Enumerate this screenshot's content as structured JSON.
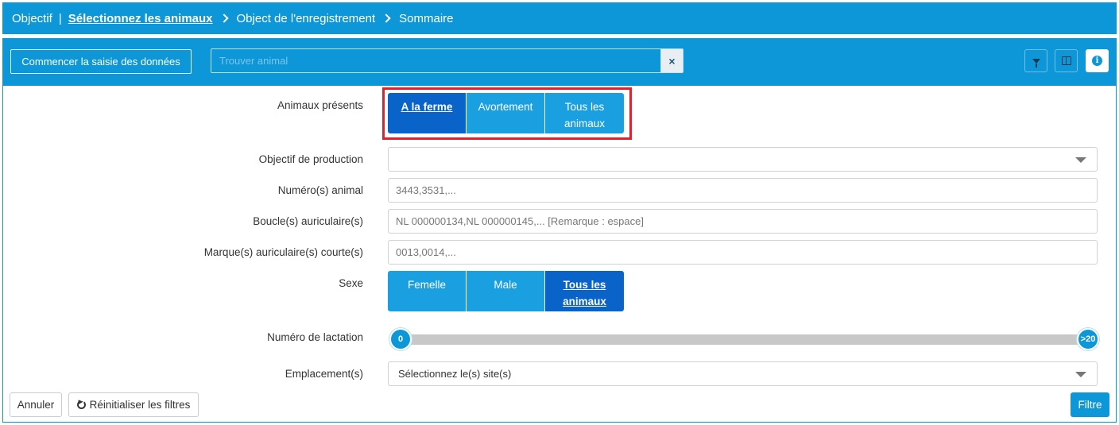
{
  "breadcrumb": {
    "steps": [
      "Objectif",
      "Sélectionnez les animaux",
      "Object de l'enregistrement",
      "Sommaire"
    ],
    "separator": "|"
  },
  "toolbar": {
    "start_label": "Commencer la saisie des données",
    "search_placeholder": "Trouver animal",
    "clear_icon": "×",
    "info_glyph": "i"
  },
  "form": {
    "animaux_presents": {
      "label": "Animaux présents",
      "options": [
        "A la ferme",
        "Avortement",
        "Tous les animaux"
      ],
      "selected": "A la ferme"
    },
    "objectif_production": {
      "label": "Objectif de production",
      "value": ""
    },
    "numero_animal": {
      "label": "Numéro(s) animal",
      "placeholder": "3443,3531,..."
    },
    "boucle": {
      "label": "Boucle(s) auriculaire(s)",
      "placeholder": "NL 000000134,NL 000000145,... [Remarque : espace]"
    },
    "marque": {
      "label": "Marque(s) auriculaire(s) courte(s)",
      "placeholder": "0013,0014,..."
    },
    "sexe": {
      "label": "Sexe",
      "options": [
        "Femelle",
        "Male",
        "Tous les animaux"
      ],
      "selected": "Tous les animaux"
    },
    "lactation": {
      "label": "Numéro de lactation",
      "min_label": "0",
      "max_label": ">20"
    },
    "emplacement": {
      "label": "Emplacement(s)",
      "value": "Sélectionnez le(s) site(s)"
    }
  },
  "footer": {
    "cancel_label": "Annuler",
    "reset_label": "Réinitialiser les filtres",
    "filter_label": "Filtre"
  },
  "colors": {
    "primary": "#0d97d8",
    "selected": "#0a63c8",
    "highlight": "#e5202a"
  }
}
